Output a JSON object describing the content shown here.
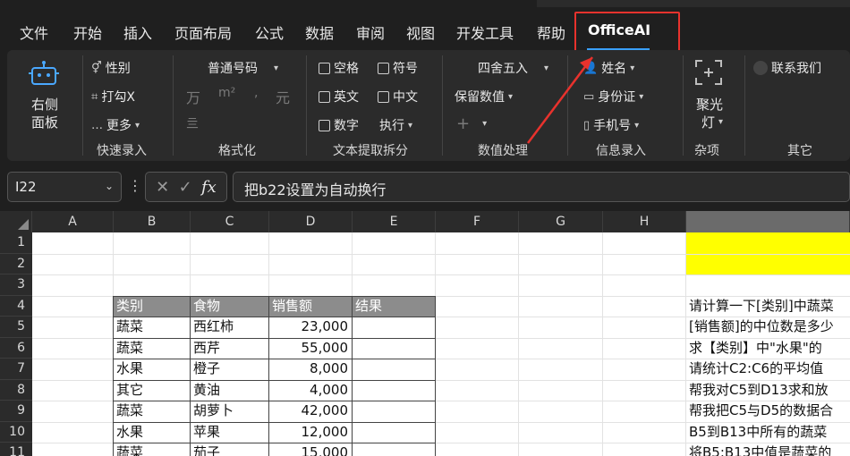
{
  "menu": {
    "tabs": [
      "文件",
      "开始",
      "插入",
      "页面布局",
      "公式",
      "数据",
      "审阅",
      "视图",
      "开发工具",
      "帮助",
      "OfficeAI"
    ],
    "active": "OfficeAI"
  },
  "ribbon": {
    "panel_label_1": "右侧",
    "panel_label_2": "面板",
    "quick_entry": {
      "gender": "性别",
      "check": "打勾X",
      "more": "更多",
      "group": "快速录入"
    },
    "format": {
      "number_format": "普通号码",
      "wan": "万",
      "sqm": "m²",
      "comma": ",",
      "yuan": "元",
      "hundred_m": "亖",
      "group": "格式化"
    },
    "text_extract": {
      "space": "空格",
      "symbol": "符号",
      "english": "英文",
      "chinese": "中文",
      "digit": "数字",
      "execute": "执行",
      "group": "文本提取拆分"
    },
    "numeric": {
      "rounding": "四舍五入",
      "keep_value": "保留数值",
      "plus": "+",
      "group": "数值处理"
    },
    "info": {
      "name": "姓名",
      "id_card": "身份证",
      "phone": "手机号",
      "group": "信息录入"
    },
    "misc": {
      "spotlight_1": "聚光",
      "spotlight_2": "灯",
      "group": "杂项"
    },
    "other": {
      "contact": "联系我们",
      "group": "其它"
    }
  },
  "formula_bar": {
    "name_box": "I22",
    "fx": "fx",
    "formula": "把b22设置为自动换行"
  },
  "grid": {
    "columns": [
      "A",
      "B",
      "C",
      "D",
      "E",
      "F",
      "G",
      "H",
      ""
    ],
    "rows": [
      "1",
      "2",
      "3",
      "4",
      "5",
      "6",
      "7",
      "8",
      "9",
      "10",
      "11"
    ],
    "table_header": [
      "类别",
      "食物",
      "销售额",
      "结果"
    ],
    "table_rows": [
      [
        "蔬菜",
        "西红柿",
        "23,000"
      ],
      [
        "蔬菜",
        "西芹",
        "55,000"
      ],
      [
        "水果",
        "橙子",
        "8,000"
      ],
      [
        "其它",
        "黄油",
        "4,000"
      ],
      [
        "蔬菜",
        "胡萝卜",
        "42,000"
      ],
      [
        "水果",
        "苹果",
        "12,000"
      ],
      [
        "蔬菜",
        "茄子",
        "15,000"
      ]
    ],
    "side_texts": [
      "请计算一下[类别]中蔬菜",
      "[销售额]的中位数是多少",
      "求【类别】中\"水果\"的",
      "请统计C2:C6的平均值",
      "帮我对C5到D13求和放",
      "帮我把C5与D5的数据合",
      "B5到B13中所有的蔬菜",
      "将B5:B13中值是蔬菜的"
    ]
  },
  "colors": {
    "accent": "#3aa0ff",
    "highlight": "#e8322d",
    "yellow_fill": "#ffff00",
    "table_header_bg": "#8c8c8c"
  }
}
